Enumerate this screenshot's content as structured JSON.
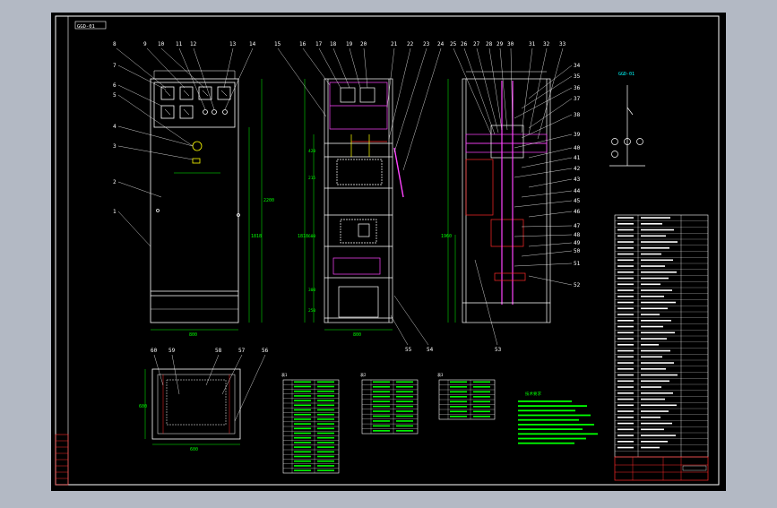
{
  "drawing": {
    "title_tag": "GGD-01",
    "callout_numbers_top": [
      "8",
      "9",
      "10",
      "11",
      "12",
      "13",
      "14",
      "15",
      "16",
      "17",
      "18",
      "19",
      "20",
      "21",
      "22",
      "23",
      "24",
      "25",
      "26",
      "27",
      "28",
      "29",
      "30",
      "31",
      "32",
      "33"
    ],
    "callout_numbers_left": [
      "7",
      "6",
      "5",
      "4",
      "3",
      "2",
      "1"
    ],
    "callout_numbers_right": [
      "34",
      "35",
      "36",
      "37",
      "38",
      "39",
      "40",
      "41",
      "42",
      "43",
      "44",
      "45",
      "46",
      "47",
      "48",
      "49",
      "50",
      "51",
      "52"
    ],
    "callout_numbers_bottom": [
      "55",
      "54",
      "53"
    ],
    "callout_numbers_plan": [
      "60",
      "59",
      "58",
      "57",
      "56"
    ],
    "dimensions": {
      "front_width": "800",
      "side_width": "800",
      "plan_width": "600",
      "front_height": "2200",
      "side_height_left": "1818",
      "side_height_right": "1960",
      "plan_depth": "600",
      "mid_dims": [
        "420",
        "215",
        "600",
        "300",
        "250"
      ]
    },
    "schematic_label": "GGD-01",
    "table1_title": "表1",
    "table2_title": "表2",
    "table3_title": "表3",
    "notes_title": "技术要求"
  },
  "colors": {
    "background": "#000000",
    "frame": "#ffffff",
    "accent_green": "#00ff00",
    "accent_red": "#ff2a2a",
    "accent_magenta": "#ff44ff",
    "accent_cyan": "#00ffff",
    "accent_yellow": "#ffff00"
  }
}
